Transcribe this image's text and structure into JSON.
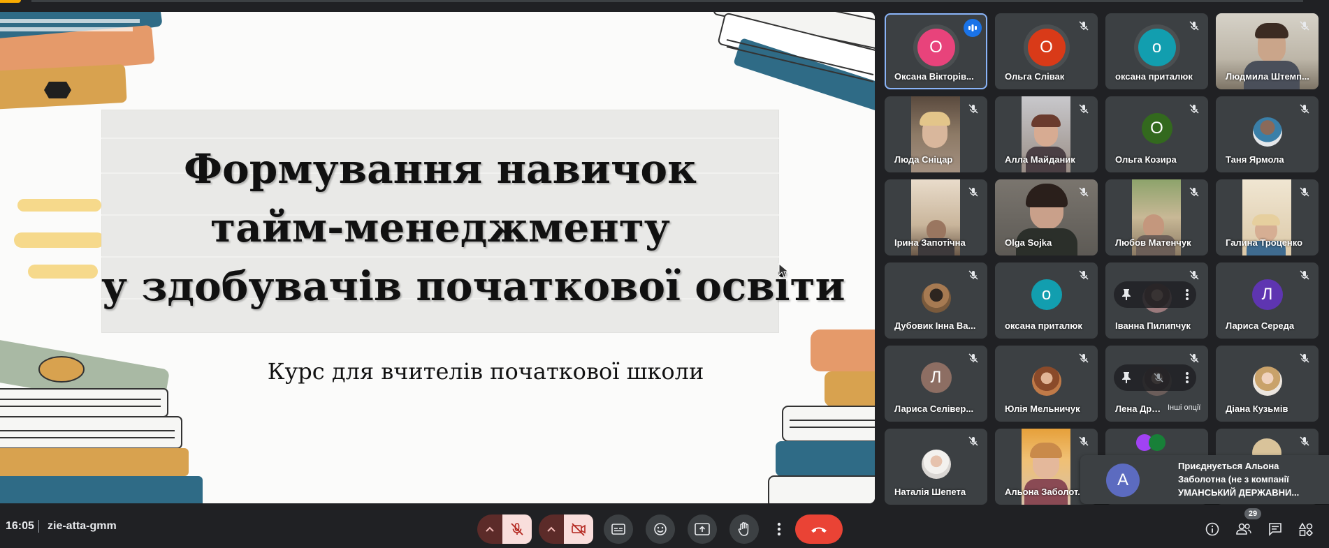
{
  "slide": {
    "title_lines": [
      "Формування навичок",
      "тайм-менеджменту",
      "у здобувачів початкової освіти"
    ],
    "subtitle": "Курс для вчителів початкової школи"
  },
  "participants": [
    {
      "name": "Оксана Вікторів...",
      "initial": "О",
      "color": "#e8437b",
      "kind": "avatar",
      "speaking": true
    },
    {
      "name": "Ольга Слівак",
      "initial": "О",
      "color": "#d93a18",
      "kind": "avatar"
    },
    {
      "name": "оксана приталюк",
      "initial": "о",
      "color": "#129eaf",
      "kind": "avatar"
    },
    {
      "name": "Людмила Штемп...",
      "kind": "video"
    },
    {
      "name": "Люда Сніцар",
      "kind": "video"
    },
    {
      "name": "Алла Майданик",
      "kind": "video"
    },
    {
      "name": "Ольга Козира",
      "initial": "О",
      "color": "#33691e",
      "kind": "avatar"
    },
    {
      "name": "Таня Ярмола",
      "kind": "photo"
    },
    {
      "name": "Ірина Запотічна",
      "kind": "video"
    },
    {
      "name": "Olga Sojka",
      "kind": "video"
    },
    {
      "name": "Любов Матенчук",
      "kind": "video"
    },
    {
      "name": "Галина Троценко",
      "kind": "video"
    },
    {
      "name": "Дубовик Інна Ва...",
      "kind": "photo"
    },
    {
      "name": "оксана приталюк",
      "initial": "о",
      "color": "#129eaf",
      "kind": "avatar"
    },
    {
      "name": "Іванна Пилипчук",
      "kind": "photo",
      "hover": true
    },
    {
      "name": "Лариса Середа",
      "initial": "Л",
      "color": "#5e35b1",
      "kind": "avatar"
    },
    {
      "name": "Лариса Селівер...",
      "initial": "Л",
      "color": "#8d6e63",
      "kind": "avatar"
    },
    {
      "name": "Юлія Мельничук",
      "kind": "photo"
    },
    {
      "name": "Лена Друм",
      "kind": "photo",
      "hover": true,
      "tooltip": "Інші опції"
    },
    {
      "name": "Діана Кузьмів",
      "kind": "photo"
    },
    {
      "name": "Наталія Шепета",
      "kind": "photo"
    },
    {
      "name": "Альона Заболот...",
      "kind": "video"
    }
  ],
  "toast": {
    "initial": "А",
    "line1": "Приєднується Альона",
    "line2": "Заболотна (не з компанії",
    "line3": "УМАНСЬКИЙ ДЕРЖАВНИ..."
  },
  "bottombar": {
    "time": "16:05",
    "meeting_code": "zie-atta-gmm",
    "people_count": "29"
  },
  "colors": {
    "background": "#202124",
    "tile": "#3c4043",
    "accent": "#8ab4f8",
    "end_call": "#ea4335",
    "muted_bg": "#f9dedc"
  }
}
